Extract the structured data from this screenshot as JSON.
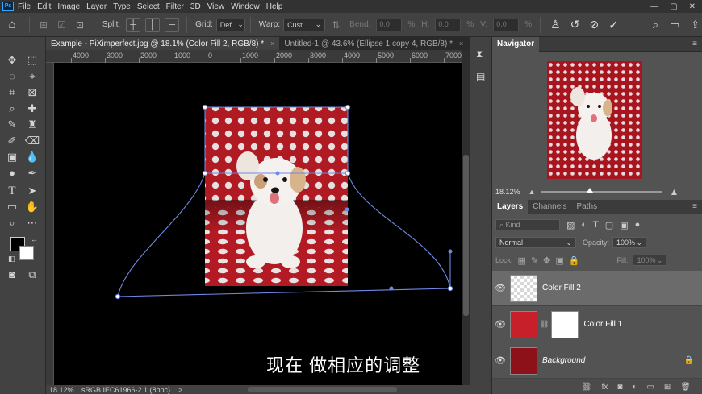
{
  "menubar": {
    "logo": "Ps",
    "items": [
      "File",
      "Edit",
      "Image",
      "Layer",
      "Type",
      "Select",
      "Filter",
      "3D",
      "View",
      "Window",
      "Help"
    ]
  },
  "options": {
    "split_label": "Split:",
    "grid_label": "Grid:",
    "grid_value": "Def...",
    "warp_label": "Warp:",
    "warp_value": "Cust...",
    "bend_label": "Bend:",
    "bend_value": "0.0",
    "h_label": "H:",
    "h_value": "0.0",
    "v_label": "V:",
    "v_value": "0.0",
    "pct": "%"
  },
  "tabs": [
    {
      "label": "Example - PiXimperfect.jpg @ 18.1% (Color Fill 2, RGB/8) *",
      "close": "×"
    },
    {
      "label": "Untitled-1 @ 43.6% (Ellipse 1 copy 4, RGB/8) *",
      "close": "×"
    }
  ],
  "ruler": {
    "labels": [
      "4000",
      "3000",
      "2000",
      "1000",
      "0",
      "1000",
      "2000",
      "3000",
      "4000",
      "5000",
      "6000",
      "7000"
    ]
  },
  "status": {
    "zoom": "18.12%",
    "profile": "sRGB IEC61966-2.1 (8bpc)",
    "arrow": ">"
  },
  "navigator": {
    "tab": "Navigator",
    "zoom": "18.12%"
  },
  "layers_panel": {
    "tabs": [
      "Layers",
      "Channels",
      "Paths"
    ],
    "kind": "Kind",
    "blend_mode": "Normal",
    "opacity_label": "Opacity:",
    "opacity_value": "100%",
    "lock_label": "Lock:",
    "fill_label": "Fill:",
    "fill_value": "100%",
    "layers": [
      {
        "name": "Color Fill 2"
      },
      {
        "name": "Color Fill 1"
      },
      {
        "name": "Background"
      }
    ]
  },
  "subtitle": "现在 做相应的调整",
  "colors": {
    "fill_red": "#c8202a",
    "accent": "#31a8ff",
    "warp_path": "#6f8ae6"
  }
}
